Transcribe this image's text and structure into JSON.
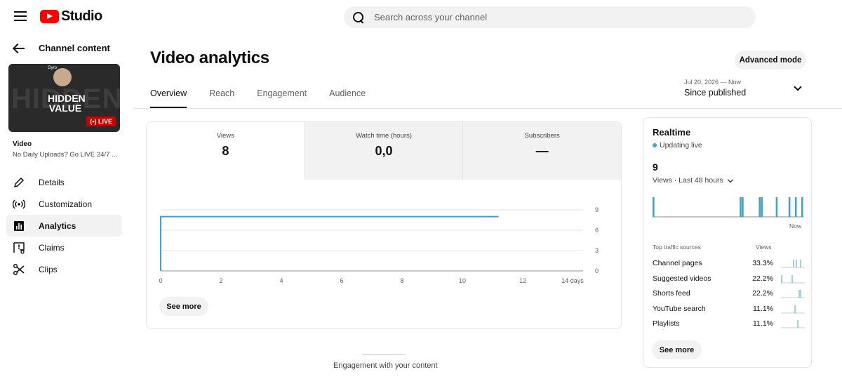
{
  "app": {
    "logo_text": "Studio"
  },
  "search": {
    "placeholder": "Search across your channel"
  },
  "sidebar": {
    "back_label": "Channel content",
    "thumbnail": {
      "bg_text": "HIDDEN",
      "title": "HIDDEN VALUE",
      "live_badge": "LIVE",
      "brand": "Gyro"
    },
    "video_label": "Video",
    "video_title": "No Daily Uploads? Go LIVE 24/7 ...",
    "items": [
      {
        "label": "Details",
        "icon": "pencil-icon",
        "active": false
      },
      {
        "label": "Customization",
        "icon": "broadcast-icon",
        "active": false
      },
      {
        "label": "Analytics",
        "icon": "analytics-icon",
        "active": true
      },
      {
        "label": "Claims",
        "icon": "claims-icon",
        "active": false
      },
      {
        "label": "Clips",
        "icon": "scissors-icon",
        "active": false
      }
    ]
  },
  "header": {
    "title": "Video analytics",
    "advanced_mode": "Advanced mode",
    "tabs": [
      "Overview",
      "Reach",
      "Engagement",
      "Audience"
    ],
    "active_tab": 0,
    "date_range": {
      "range": "Jul 20, 2026 — Now",
      "label": "Since published"
    }
  },
  "metrics": [
    {
      "label": "Views",
      "value": "8"
    },
    {
      "label": "Watch time (hours)",
      "value": "0,0"
    },
    {
      "label": "Subscribers",
      "value": "—"
    }
  ],
  "see_more": "See more",
  "chart_data": {
    "type": "line",
    "x_ticks": [
      "0",
      "2",
      "4",
      "6",
      "8",
      "10",
      "12",
      "14 days"
    ],
    "y_ticks": [
      "0",
      "3",
      "6",
      "9"
    ],
    "xlim": [
      0,
      14
    ],
    "ylim": [
      0,
      9
    ],
    "series": [
      {
        "x": [
          0,
          0,
          11.2
        ],
        "y": [
          0,
          8,
          8
        ]
      }
    ],
    "grid": true,
    "color": "#41a4c4"
  },
  "realtime": {
    "title": "Realtime",
    "status": "Updating live",
    "count": "9",
    "period": "Views · Last 48 hours",
    "now_label": "Now",
    "bars": [
      1,
      0,
      0,
      0,
      0,
      0,
      0,
      0,
      0,
      0,
      0,
      0,
      0,
      0,
      0,
      0,
      0,
      0,
      0,
      0,
      0,
      0,
      0,
      0,
      0,
      0,
      0,
      0,
      0,
      0,
      0,
      0,
      0,
      0,
      0,
      0,
      0,
      0,
      0,
      0,
      0,
      1,
      1,
      0,
      0,
      0,
      0,
      0,
      0,
      0,
      1,
      1,
      0,
      0,
      0,
      0,
      0,
      0,
      1,
      0,
      0,
      0,
      0,
      0,
      1,
      0,
      0,
      1,
      0,
      0,
      1
    ],
    "traffic_header": {
      "label": "Top traffic sources",
      "views": "Views"
    },
    "traffic_sources": [
      {
        "name": "Channel pages",
        "pct": "33.3%"
      },
      {
        "name": "Suggested videos",
        "pct": "22.2%"
      },
      {
        "name": "Shorts feed",
        "pct": "22.2%"
      },
      {
        "name": "YouTube search",
        "pct": "11.1%"
      },
      {
        "name": "Playlists",
        "pct": "11.1%"
      }
    ],
    "see_more": "See more"
  },
  "bottom": {
    "section_label": "Engagement with your content"
  }
}
